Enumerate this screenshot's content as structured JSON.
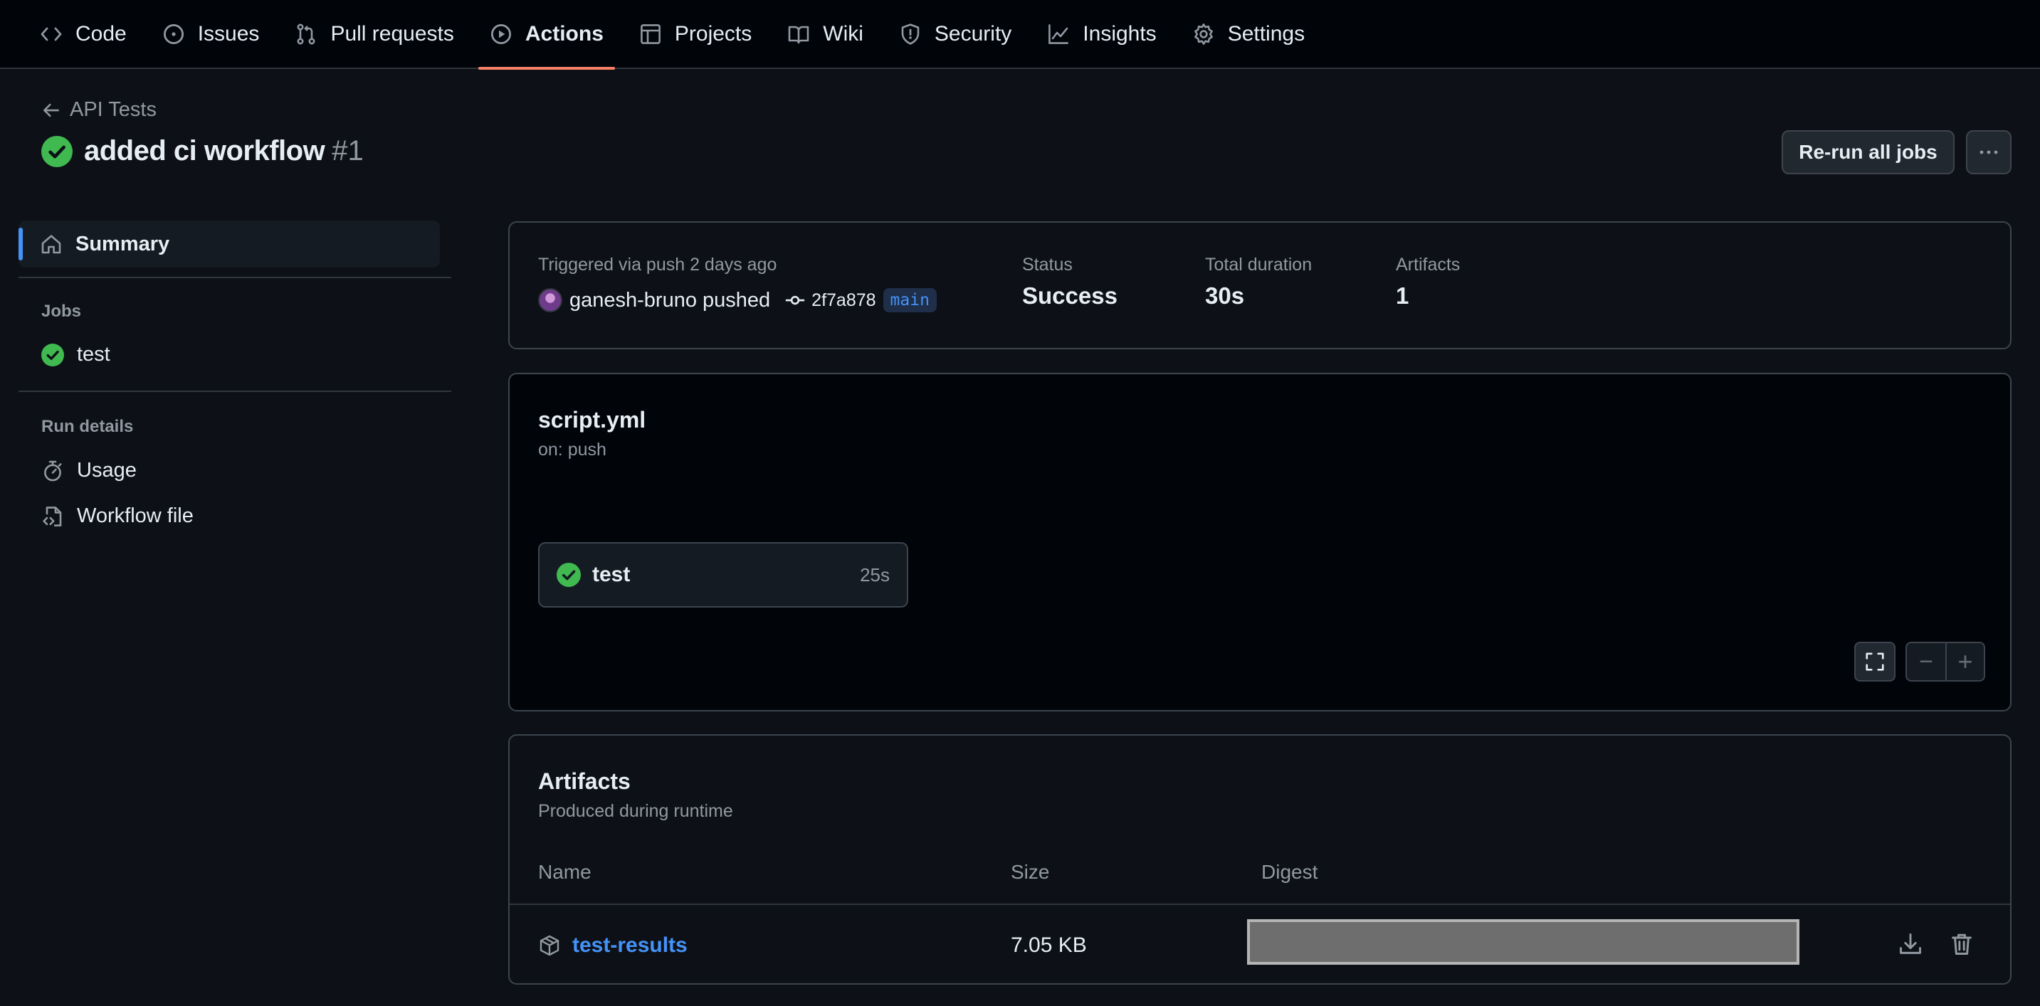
{
  "repo_nav": {
    "tabs": [
      {
        "label": "Code",
        "icon": "code-icon"
      },
      {
        "label": "Issues",
        "icon": "issue-opened-icon"
      },
      {
        "label": "Pull requests",
        "icon": "git-pull-request-icon"
      },
      {
        "label": "Actions",
        "icon": "play-icon",
        "active": true
      },
      {
        "label": "Projects",
        "icon": "table-icon"
      },
      {
        "label": "Wiki",
        "icon": "book-icon"
      },
      {
        "label": "Security",
        "icon": "shield-icon"
      },
      {
        "label": "Insights",
        "icon": "graph-icon"
      },
      {
        "label": "Settings",
        "icon": "gear-icon"
      }
    ],
    "active_underline_color": "#f78166"
  },
  "header": {
    "back_label": "API Tests",
    "title": "added ci workflow",
    "run_number": "#1",
    "status_color": "#3fb950",
    "rerun_label": "Re-run all jobs",
    "more_label": "···"
  },
  "sidebar": {
    "summary_label": "Summary",
    "jobs_heading": "Jobs",
    "jobs": [
      {
        "label": "test",
        "status": "success"
      }
    ],
    "run_details_heading": "Run details",
    "run_details": [
      {
        "label": "Usage",
        "icon": "stopwatch-icon"
      },
      {
        "label": "Workflow file",
        "icon": "file-code-icon"
      }
    ]
  },
  "summary": {
    "triggered_text": "Triggered via push 2 days ago",
    "actor_text": "ganesh-bruno pushed",
    "commit_sha": "2f7a878",
    "branch": "main",
    "status_label": "Status",
    "status_value": "Success",
    "duration_label": "Total duration",
    "duration_value": "30s",
    "artifacts_label": "Artifacts",
    "artifacts_value": "1"
  },
  "workflow_graph": {
    "file_name": "script.yml",
    "trigger": "on: push",
    "jobs": [
      {
        "name": "test",
        "duration": "25s",
        "status": "success"
      }
    ],
    "zoom_out_label": "−",
    "zoom_in_label": "+"
  },
  "artifacts": {
    "title": "Artifacts",
    "subtitle": "Produced during runtime",
    "columns": [
      "Name",
      "Size",
      "Digest"
    ],
    "rows": [
      {
        "name": "test-results",
        "size": "7.05 KB"
      }
    ]
  }
}
